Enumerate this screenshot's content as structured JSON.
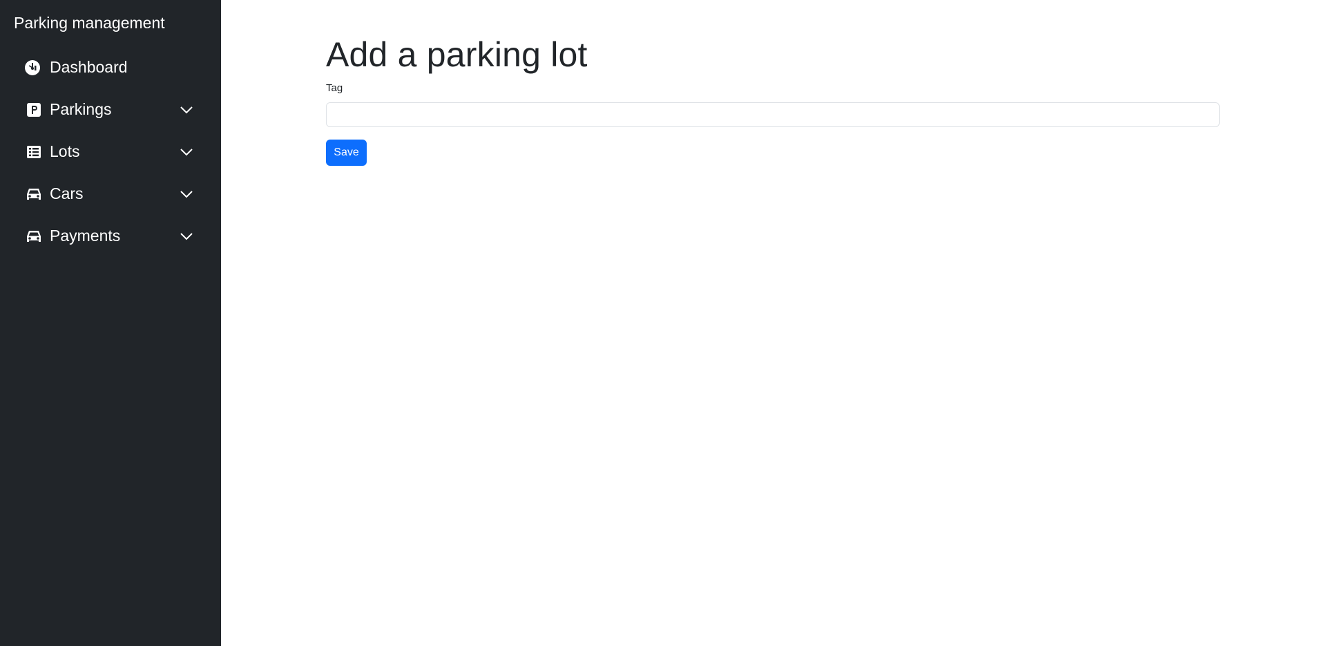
{
  "sidebar": {
    "brand": "Parking management",
    "items": [
      {
        "label": "Dashboard",
        "icon": "dashboard-gauge-icon",
        "expandable": false
      },
      {
        "label": "Parkings",
        "icon": "parking-sign-icon",
        "expandable": true
      },
      {
        "label": "Lots",
        "icon": "list-table-icon",
        "expandable": true
      },
      {
        "label": "Cars",
        "icon": "car-icon",
        "expandable": true
      },
      {
        "label": "Payments",
        "icon": "car-icon",
        "expandable": true
      }
    ]
  },
  "main": {
    "title": "Add a parking lot",
    "form": {
      "tag_label": "Tag",
      "tag_value": "",
      "tag_placeholder": "",
      "save_label": "Save"
    }
  },
  "colors": {
    "sidebar_bg": "#212529",
    "primary": "#0d6efd",
    "text": "#212529",
    "input_border": "#dee2e6"
  }
}
